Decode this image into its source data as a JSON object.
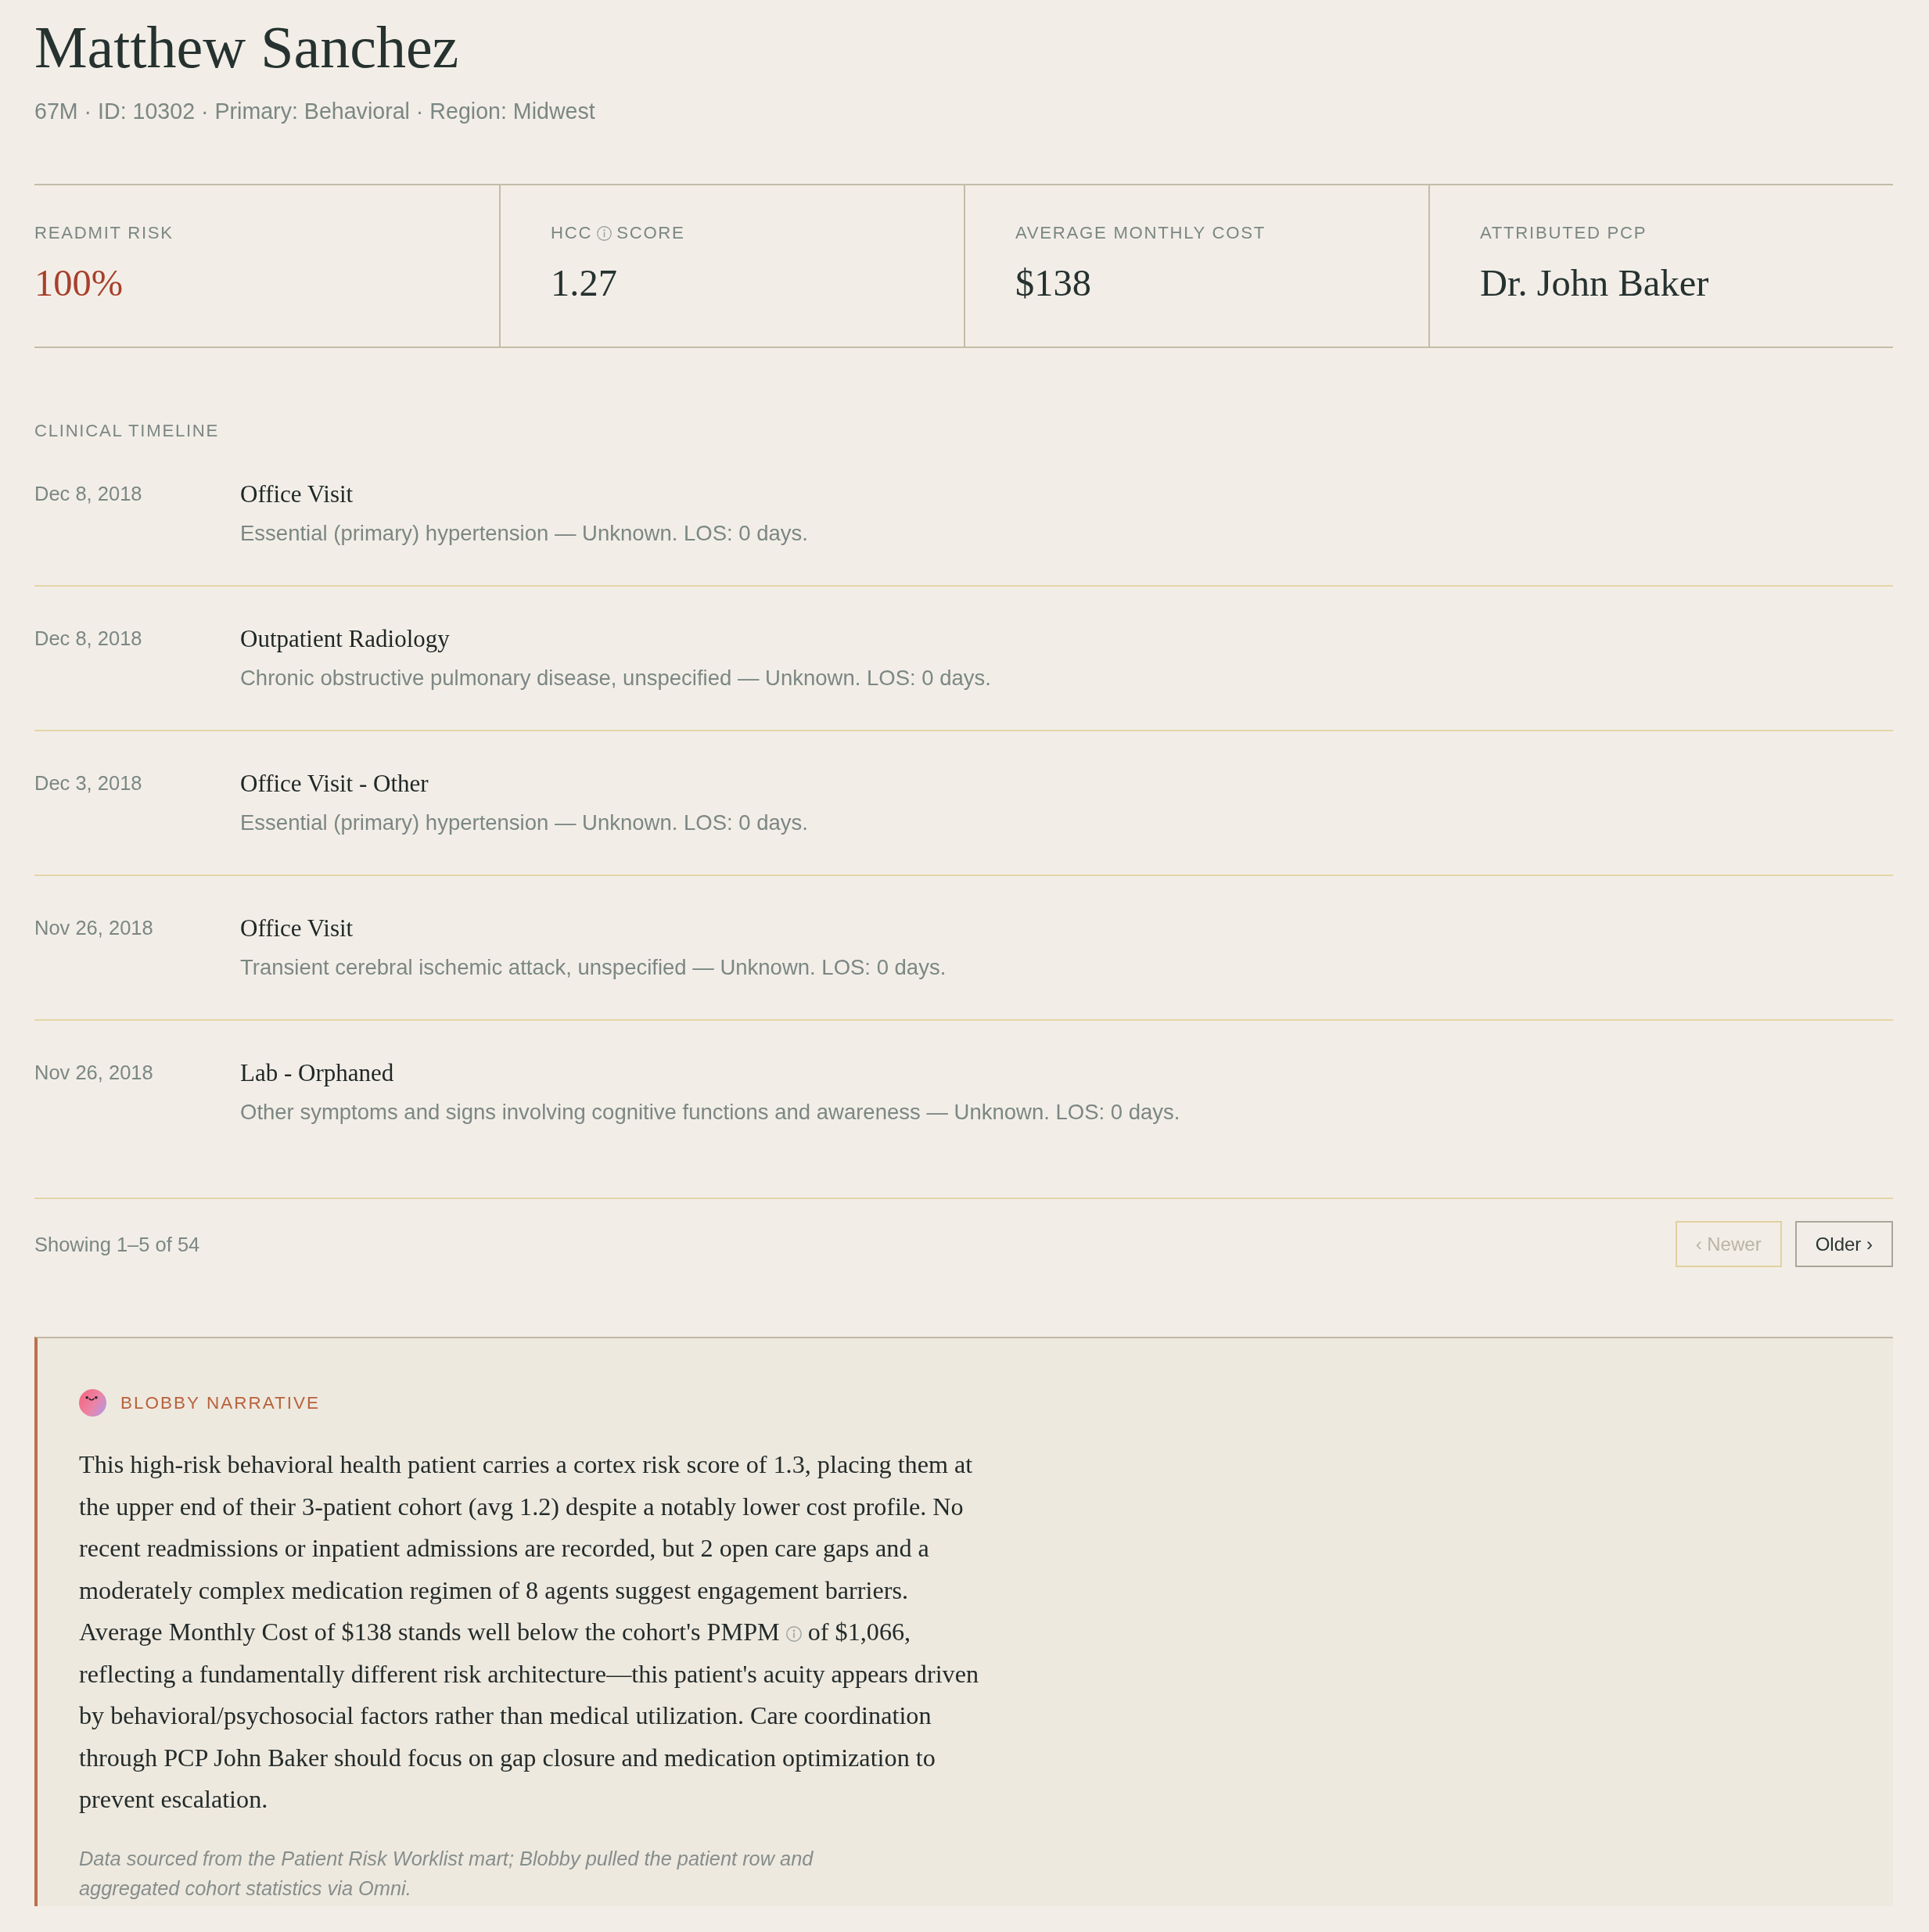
{
  "patient": {
    "name": "Matthew Sanchez",
    "summary": "67M · ID: 10302 · Primary: Behavioral · Region: Midwest"
  },
  "metrics": [
    {
      "label": "READMIT RISK",
      "info": false,
      "value": "100%",
      "alert": true
    },
    {
      "label": "HCC",
      "info": true,
      "label_after": "SCORE",
      "value": "1.27",
      "alert": false
    },
    {
      "label": "AVERAGE MONTHLY COST",
      "info": false,
      "value": "$138",
      "alert": false
    },
    {
      "label": "ATTRIBUTED PCP",
      "info": false,
      "value": "Dr. John Baker",
      "alert": false
    }
  ],
  "timeline": {
    "heading": "CLINICAL TIMELINE",
    "entries": [
      {
        "date": "Dec 8, 2018",
        "title": "Office Visit",
        "detail": "Essential (primary) hypertension — Unknown. LOS: 0 days."
      },
      {
        "date": "Dec 8, 2018",
        "title": "Outpatient Radiology",
        "detail": "Chronic obstructive pulmonary disease, unspecified — Unknown. LOS: 0 days."
      },
      {
        "date": "Dec 3, 2018",
        "title": "Office Visit - Other",
        "detail": "Essential (primary) hypertension — Unknown. LOS: 0 days."
      },
      {
        "date": "Nov 26, 2018",
        "title": "Office Visit",
        "detail": "Transient cerebral ischemic attack, unspecified — Unknown. LOS: 0 days."
      },
      {
        "date": "Nov 26, 2018",
        "title": "Lab - Orphaned",
        "detail": "Other symptoms and signs involving cognitive functions and awareness — Unknown. LOS: 0 days."
      }
    ]
  },
  "pagination": {
    "summary": "Showing 1–5 of 54",
    "buttons": [
      {
        "label": "‹ Newer",
        "disabled": true
      },
      {
        "label": "Older ›",
        "disabled": false
      }
    ]
  },
  "narrative": {
    "title": "BLOBBY NARRATIVE",
    "body": [
      "This high-risk behavioral health patient carries a cortex risk score of 1.3, placing them at the upper end of their 3-patient cohort (avg 1.2) despite a notably lower cost profile. No recent readmissions or inpatient admissions are recorded, but 2 open care gaps and a moderately complex medication regimen of 8 agents suggest engagement barriers. Average Monthly Cost of $138 stands well below the cohort's PMPM",
      "of $1,066, reflecting a fundamentally different risk architecture—this patient's acuity appears driven by behavioral/psychosocial factors rather than medical utilization. Care coordination through PCP John Baker should focus on gap closure and medication optimization to prevent escalation."
    ],
    "note": "Data sourced from the Patient Risk Worklist mart; Blobby pulled the patient row and aggregated cohort statistics via Omni."
  }
}
